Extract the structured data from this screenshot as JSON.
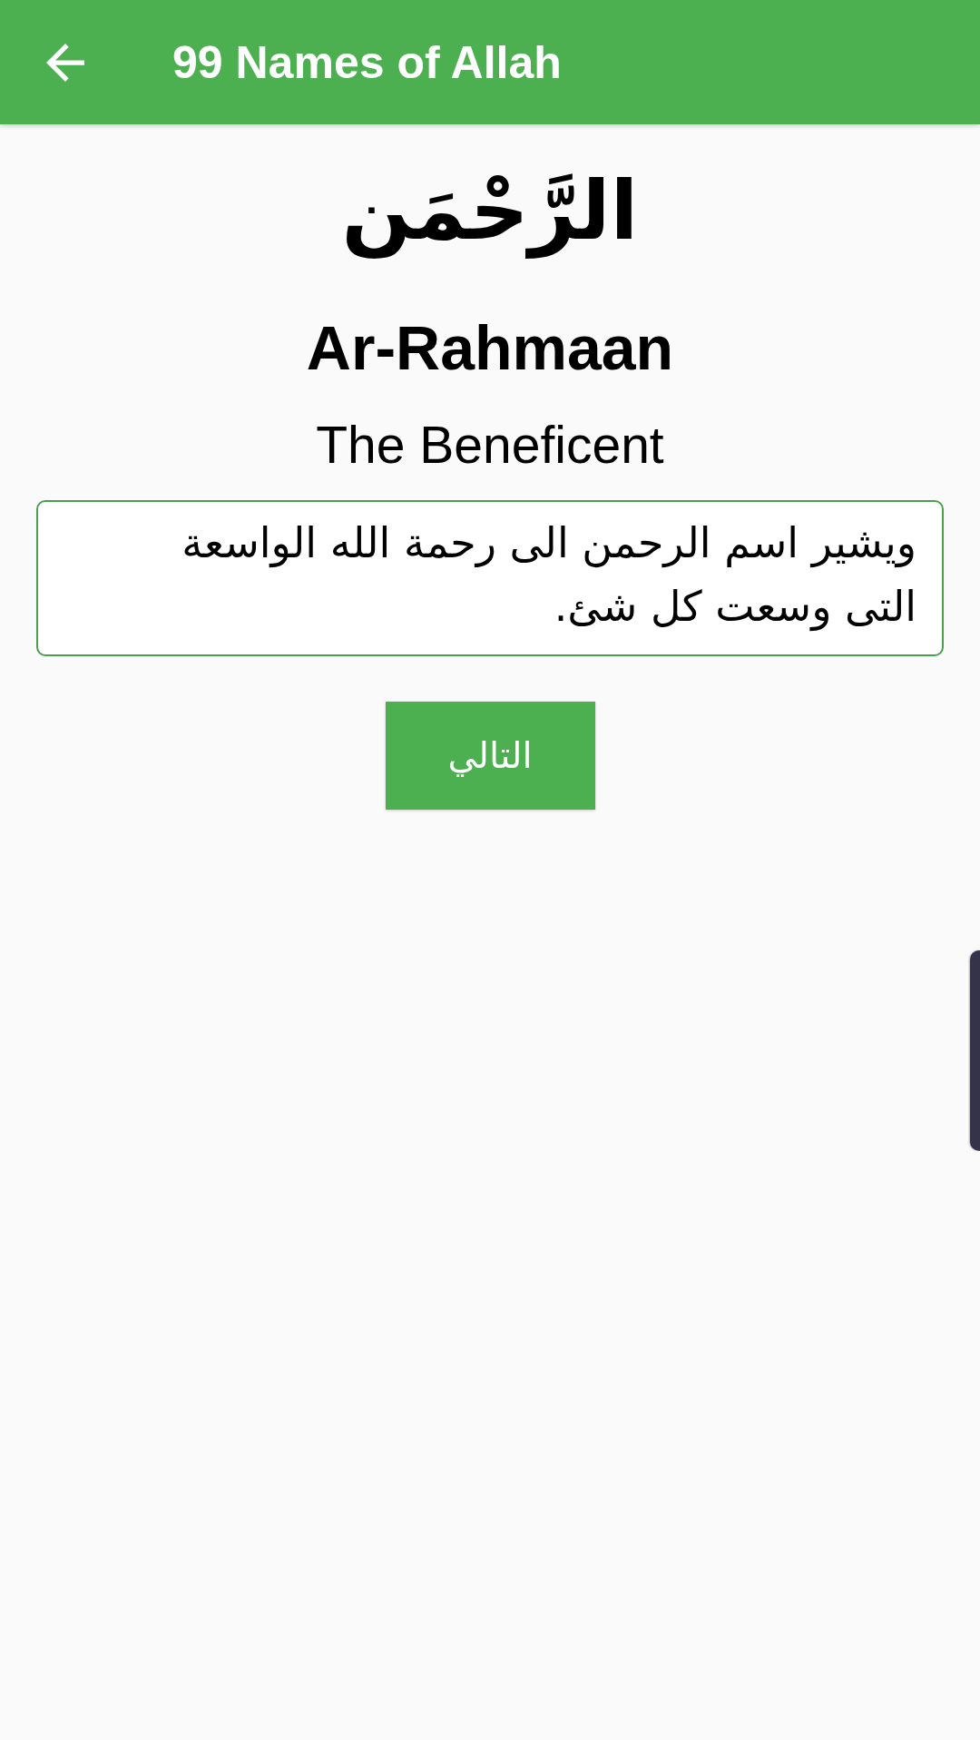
{
  "app_bar": {
    "title": "99 Names of Allah"
  },
  "name": {
    "arabic": "الرَّحْمَن",
    "transliteration": "Ar-Rahmaan",
    "meaning": "The Beneficent"
  },
  "description": "ويشير اسم الرحمن الى رحمة الله الواسعة التى وسعت كل شئ.",
  "buttons": [
    {
      "kind": "next",
      "label": "التالي"
    }
  ]
}
